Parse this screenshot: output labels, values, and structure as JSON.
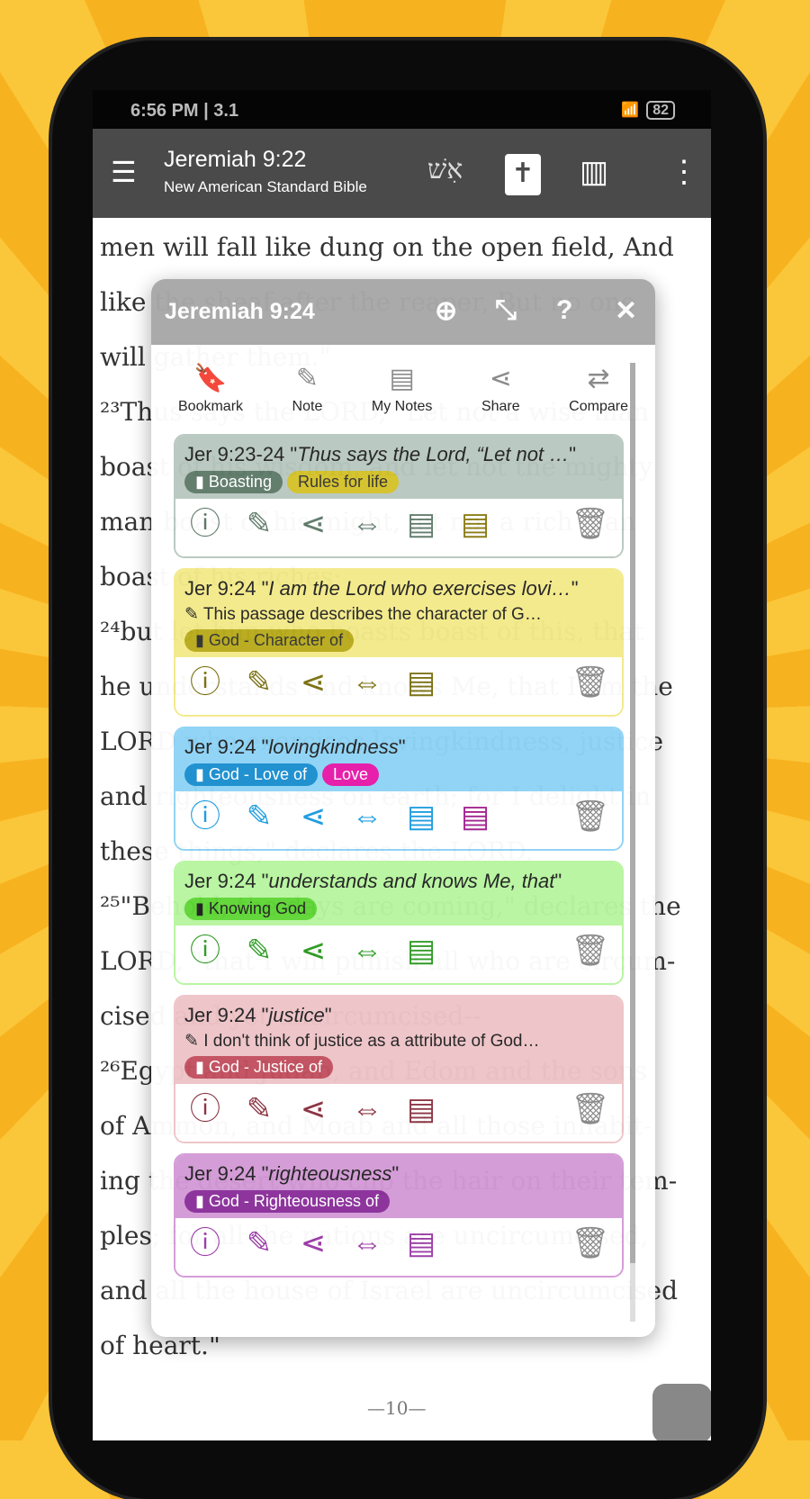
{
  "status": {
    "time": "6:56 PM | 3.1",
    "battery": "82"
  },
  "appbar": {
    "title": "Jeremiah 9:22",
    "subtitle": "New American Standard Bible",
    "hebrew": "אִשׁ"
  },
  "bible_lines": [
    "men will fall like dung on the open field, And",
    "like the sheaf after the reaper, But no one",
    "will gather them.\"",
    "²³Thus says the LORD, \"Let not a wise man",
    "boast of his wisdom, and let not the mighty",
    "man boast of his might, let not a rich man",
    "boast of his riches;",
    "²⁴but let him who boasts boast of this, that",
    "he understands and knows Me, that I am the",
    "LORD who exercises lovingkindness, justice",
    "and righteousness on earth; for I delight in",
    "these things,\" declares the LORD.",
    "²⁵\"Behold, the days are coming,\" declares the",
    "LORD, \"that I will punish all who are circum-",
    "cised and yet uncircumcised--",
    "²⁶Egypt and Judah, and Edom and the sons",
    "of Ammon, and Moab and all those inhabit-",
    "ing the desert who clip the hair on their tem-",
    "ples; for all the nations are uncircumcised,",
    "and all the house of Israel are uncircumcised",
    "of heart.\""
  ],
  "page_number": "—10—",
  "popup": {
    "title": "Jeremiah 9:24",
    "tools": [
      {
        "label": "Bookmark",
        "icon": "bookmark-add-icon"
      },
      {
        "label": "Note",
        "icon": "note-add-icon"
      },
      {
        "label": "My Notes",
        "icon": "document-icon"
      },
      {
        "label": "Share",
        "icon": "share-icon"
      },
      {
        "label": "Compare",
        "icon": "compare-icon"
      }
    ],
    "cards": [
      {
        "ref": "Jer 9:23-24 \"",
        "quote": "Thus says the Lord, “Let not …",
        "note": "",
        "bg": "#b8c8bf",
        "border": "#b8c8bf",
        "icon": "#5f7a6a",
        "extra": "#8a7a12",
        "tags": [
          {
            "label": "Boasting",
            "bg": "#5f7a6a",
            "fg": "#fff",
            "bookmark": true
          },
          {
            "label": "Rules for life",
            "bg": "#d4c22a",
            "fg": "#333",
            "bookmark": false
          }
        ]
      },
      {
        "ref": "Jer 9:24 \"",
        "quote": "I am the Lord who exercises lovi…",
        "note": "This passage describes the character of G…",
        "bg": "#f3ea8a",
        "border": "#f3ea8a",
        "icon": "#7a7010",
        "extra": "",
        "tags": [
          {
            "label": "God - Character of",
            "bg": "#b8ab1c",
            "fg": "#333",
            "bookmark": true
          }
        ]
      },
      {
        "ref": "Jer 9:24 \"",
        "quote": "lovingkindness",
        "note": "",
        "bg": "#8fd3f5",
        "border": "#8fd3f5",
        "icon": "#1a9be0",
        "extra": "#a0208e",
        "tags": [
          {
            "label": "God - Love of",
            "bg": "#1a8ecf",
            "fg": "#fff",
            "bookmark": true
          },
          {
            "label": "Love",
            "bg": "#e619a8",
            "fg": "#fff",
            "bookmark": false
          }
        ]
      },
      {
        "ref": "Jer 9:24 \"",
        "quote": "understands and knows Me, that",
        "note": "",
        "bg": "#b7f5a0",
        "border": "#b7f5a0",
        "icon": "#2c9a22",
        "extra": "",
        "tags": [
          {
            "label": "Knowing God",
            "bg": "#5fd636",
            "fg": "#222",
            "bookmark": true
          }
        ]
      },
      {
        "ref": "Jer 9:24 \"",
        "quote": "justice",
        "note": "I don't think of justice as a attribute of God…",
        "bg": "#eec4c8",
        "border": "#eec4c8",
        "icon": "#8a3040",
        "extra": "",
        "tags": [
          {
            "label": "God - Justice of",
            "bg": "#c2505f",
            "fg": "#fff",
            "bookmark": true
          }
        ]
      },
      {
        "ref": "Jer 9:24 \"",
        "quote": "righteousness",
        "note": "",
        "bg": "#d39ad6",
        "border": "#d39ad6",
        "icon": "#9a3aa6",
        "extra": "",
        "tags": [
          {
            "label": "God - Righteousness of",
            "bg": "#8a2f9a",
            "fg": "#fff",
            "bookmark": true
          }
        ]
      }
    ]
  }
}
